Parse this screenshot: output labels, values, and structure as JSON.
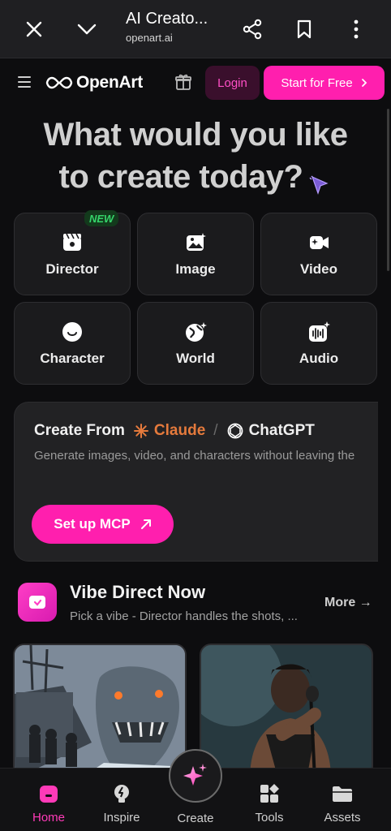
{
  "browser": {
    "title": "AI Creato...",
    "url": "openart.ai"
  },
  "header": {
    "logo": "OpenArt",
    "login_label": "Login",
    "start_label": "Start for Free"
  },
  "hero": {
    "line1": "What would you like",
    "line2": "to create today?"
  },
  "tiles": [
    {
      "label": "Director",
      "icon": "director-icon",
      "badge": "NEW"
    },
    {
      "label": "Image",
      "icon": "image-icon"
    },
    {
      "label": "Video",
      "icon": "video-icon"
    },
    {
      "label": "Character",
      "icon": "character-icon"
    },
    {
      "label": "World",
      "icon": "world-icon"
    },
    {
      "label": "Audio",
      "icon": "audio-icon"
    }
  ],
  "mcp": {
    "create_from": "Create From",
    "claude": "Claude",
    "slash": "/",
    "chatgpt": "ChatGPT",
    "description": "Generate images, video, and characters without leaving the",
    "button": "Set up MCP"
  },
  "vibe": {
    "title": "Vibe Direct Now",
    "subtitle": "Pick a vibe - Director handles the shots, ...",
    "more": "More →"
  },
  "nav": [
    {
      "label": "Home",
      "active": true
    },
    {
      "label": "Inspire"
    },
    {
      "label": "Create"
    },
    {
      "label": "Tools"
    },
    {
      "label": "Assets"
    }
  ],
  "colors": {
    "accent": "#ff1fae",
    "claude": "#e57a3c",
    "new_badge": "#35d56a"
  }
}
